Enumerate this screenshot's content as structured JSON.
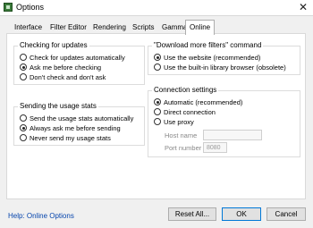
{
  "window": {
    "title": "Options",
    "close_glyph": "✕"
  },
  "tabs": [
    {
      "label": "Interface"
    },
    {
      "label": "Filter Editor"
    },
    {
      "label": "Rendering"
    },
    {
      "label": "Scripts"
    },
    {
      "label": "Gamma"
    },
    {
      "label": "Online",
      "active": true
    }
  ],
  "updates": {
    "title": "Checking for updates",
    "options": [
      {
        "label": "Check for updates automatically",
        "selected": false
      },
      {
        "label": "Ask me before checking",
        "selected": true
      },
      {
        "label": "Don't check and don't ask",
        "selected": false
      }
    ]
  },
  "usage": {
    "title": "Sending the usage stats",
    "options": [
      {
        "label": "Send the usage stats automatically",
        "selected": false
      },
      {
        "label": "Always ask me before sending",
        "selected": true
      },
      {
        "label": "Never send my usage stats",
        "selected": false
      }
    ]
  },
  "download": {
    "title": "\"Download more filters\" command",
    "options": [
      {
        "label": "Use the website (recommended)",
        "selected": true
      },
      {
        "label": "Use the built-in library browser (obsolete)",
        "selected": false
      }
    ]
  },
  "connection": {
    "title": "Connection settings",
    "options": [
      {
        "label": "Automatic (recommended)",
        "selected": true
      },
      {
        "label": "Direct connection",
        "selected": false
      },
      {
        "label": "Use proxy",
        "selected": false
      }
    ],
    "host_label": "Host name",
    "host_value": "",
    "port_label": "Port number",
    "port_value": "8080"
  },
  "footer": {
    "help_link": "Help: Online Options",
    "reset_label": "Reset All...",
    "ok_label": "OK",
    "cancel_label": "Cancel"
  },
  "colors": {
    "link": "#0645ad",
    "default_button_border": "#0078d7"
  },
  "icons": {
    "app": "app-icon",
    "close": "close-icon",
    "radio": "radio-icon"
  }
}
